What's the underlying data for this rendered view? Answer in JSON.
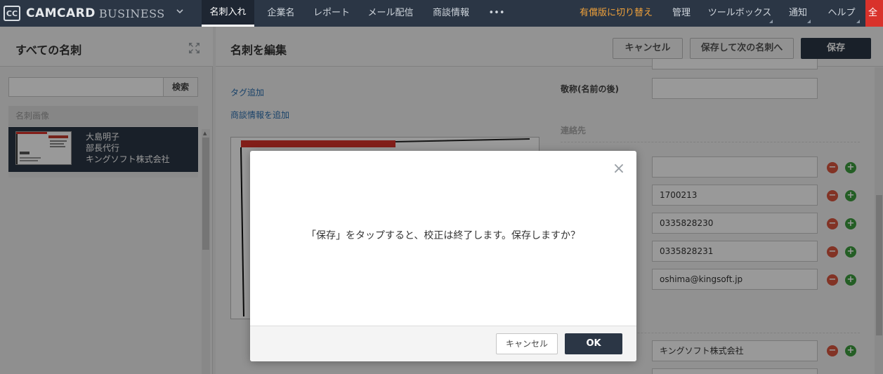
{
  "app": {
    "logo_box": "CC",
    "logo_text1": "CAMCARD",
    "logo_text2": "BUSINESS"
  },
  "nav": {
    "items": [
      "名刺入れ",
      "企業名",
      "レポート",
      "メール配信",
      "商談情報",
      "•••"
    ],
    "upgrade": "有償版に切り替え",
    "right_items": [
      "管理",
      "ツールボックス",
      "通知",
      "ヘルプ"
    ],
    "red_item": "全"
  },
  "left": {
    "title": "すべての名刺",
    "search_placeholder": "",
    "search_button": "検索",
    "section_label": "名刺画像",
    "card": {
      "name": "大島明子",
      "title": "部長代行",
      "company": "キングソフト株式会社"
    }
  },
  "editor": {
    "title": "名刺を編集",
    "cancel": "キャンセル",
    "save_next": "保存して次の名刺へ",
    "save": "保存",
    "add_tag": "タグ追加",
    "add_deal": "商談情報を追加",
    "honorific_label": "敬称(名前の後)",
    "contact_section": "連絡先",
    "fields": [
      "",
      "1700213",
      "0335828230",
      "0335828231",
      "oshima@kingsoft.jp"
    ],
    "company_field": "キングソフト株式会社"
  },
  "modal": {
    "message": "「保存」をタップすると、校正は終了します。保存しますか？",
    "cancel": "キャンセル",
    "ok": "OK",
    "close": "×"
  },
  "colors": {
    "nav_bg": "#2b3645",
    "upgrade": "#f0a13a",
    "accent_red": "#d9322b",
    "link": "#2a6fb0"
  }
}
